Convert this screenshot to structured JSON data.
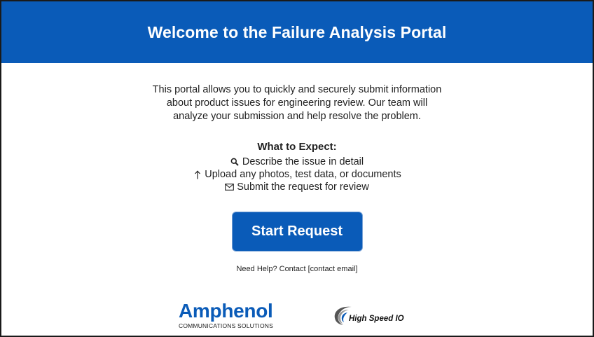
{
  "header": {
    "title": "Welcome to the Failure Analysis Portal"
  },
  "intro": {
    "lines": [
      "This portal allows you to quickly and securely submit information",
      "about product issues for engineering review. Our team will",
      "analyze your submission and help resolve the problem."
    ]
  },
  "expect": {
    "title": "What to Expect:",
    "items": [
      {
        "icon": "search-icon",
        "text": "Describe the issue in detail"
      },
      {
        "icon": "upload-arrow-icon",
        "text": "Upload any photos, test data, or documents"
      },
      {
        "icon": "envelope-icon",
        "text": "Submit the request for review"
      }
    ]
  },
  "actions": {
    "start_label": "Start Request"
  },
  "help": {
    "prefix": "Need Help? Contact ",
    "contact": "[contact email]"
  },
  "logos": {
    "amphenol_name": "Amphenol",
    "amphenol_sub": "COMMUNICATIONS SOLUTIONS",
    "hsio_name": "High Speed IO"
  },
  "colors": {
    "brand_blue": "#0a5bb8",
    "text": "#222222"
  }
}
